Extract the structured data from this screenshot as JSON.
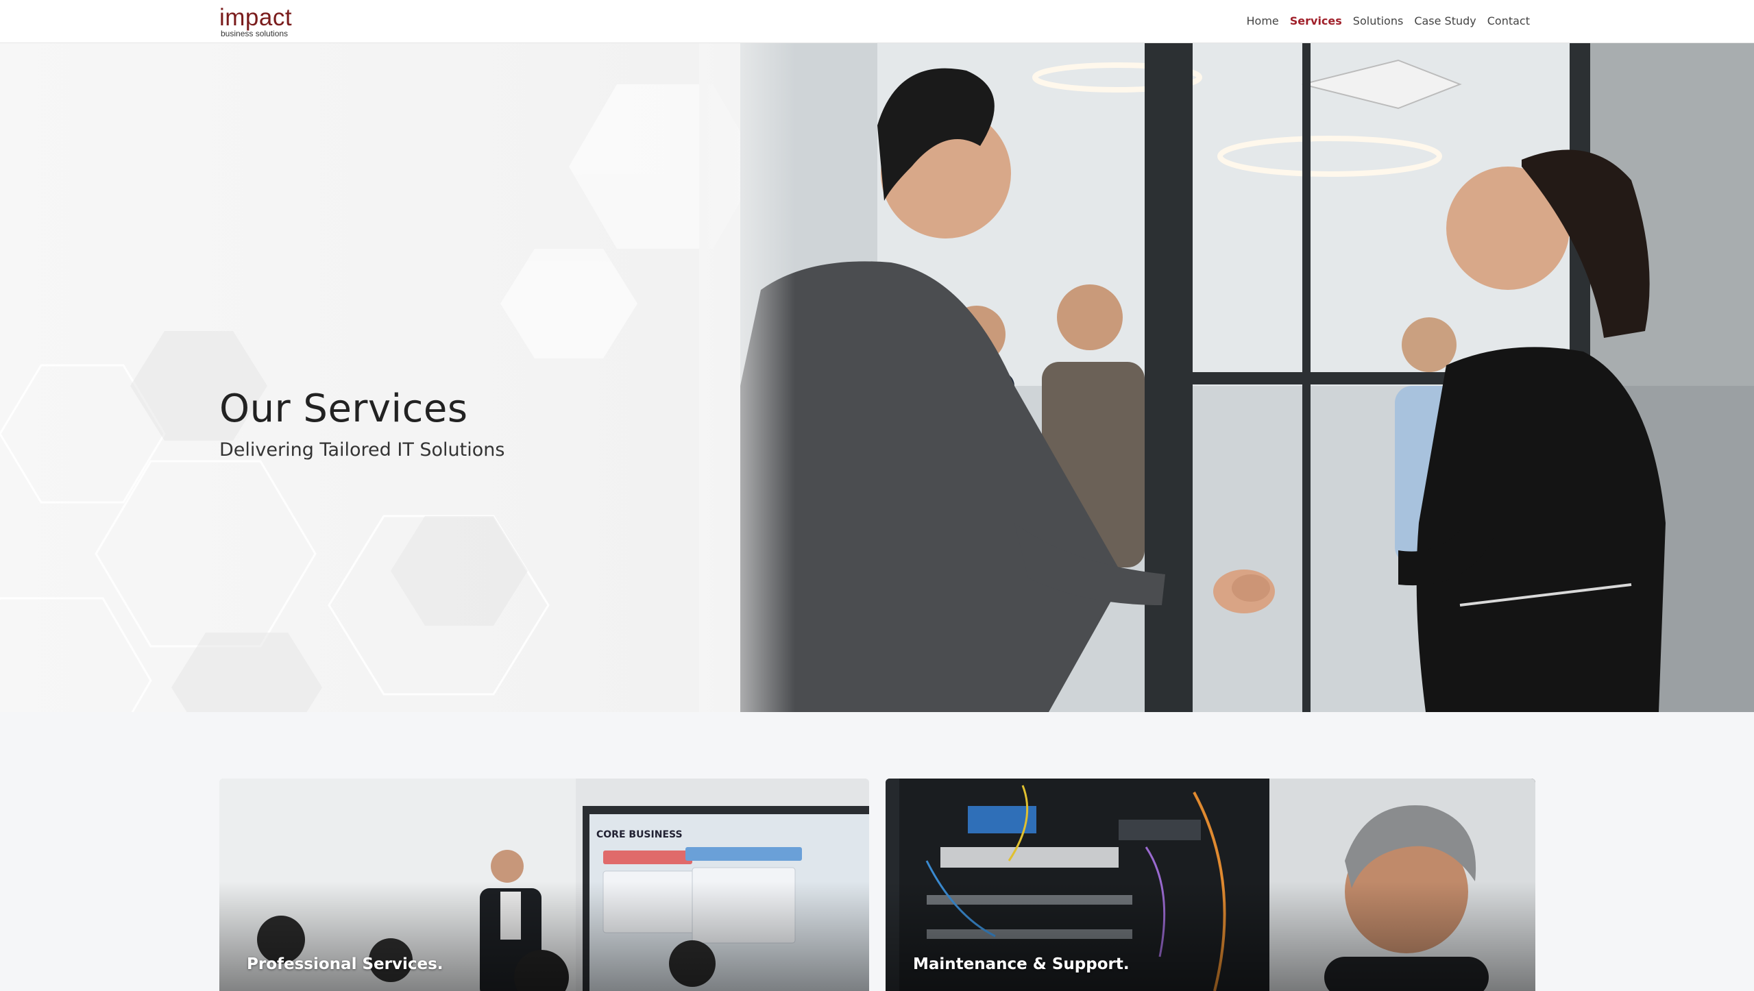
{
  "brand": {
    "name": "impact",
    "tagline": "business solutions",
    "accent_color": "#a0202a"
  },
  "nav": {
    "items": [
      {
        "label": "Home",
        "active": false
      },
      {
        "label": "Services",
        "active": true
      },
      {
        "label": "Solutions",
        "active": false
      },
      {
        "label": "Case Study",
        "active": false
      },
      {
        "label": "Contact",
        "active": false
      }
    ]
  },
  "hero": {
    "title": "Our Services",
    "subtitle": "Delivering Tailored IT Solutions"
  },
  "services": {
    "cards": [
      {
        "title": "Professional Services.",
        "screen_heading": "CORE BUSINESS"
      },
      {
        "title": "Maintenance & Support."
      }
    ]
  }
}
